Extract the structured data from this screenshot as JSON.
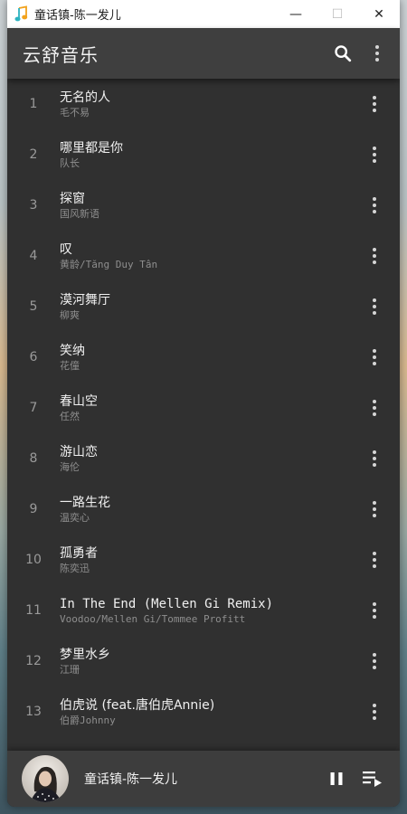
{
  "window": {
    "title": "童话镇-陈一发儿",
    "controls": {
      "minimize": "—",
      "maximize": "☐",
      "close": "✕"
    }
  },
  "appbar": {
    "title": "云舒音乐",
    "search_icon": "search-icon",
    "more_icon": "more-vert-icon"
  },
  "songs": [
    {
      "index": "1",
      "title": "无名的人",
      "artist": "毛不易"
    },
    {
      "index": "2",
      "title": "哪里都是你",
      "artist": "队长"
    },
    {
      "index": "3",
      "title": "探窗",
      "artist": "国风新语"
    },
    {
      "index": "4",
      "title": "叹",
      "artist": "黄龄/Tăng Duy Tân"
    },
    {
      "index": "5",
      "title": "漠河舞厅",
      "artist": "柳爽"
    },
    {
      "index": "6",
      "title": "笑纳",
      "artist": "花僮"
    },
    {
      "index": "7",
      "title": "春山空",
      "artist": "任然"
    },
    {
      "index": "8",
      "title": "游山恋",
      "artist": "海伦"
    },
    {
      "index": "9",
      "title": "一路生花",
      "artist": "温奕心"
    },
    {
      "index": "10",
      "title": "孤勇者",
      "artist": "陈奕迅"
    },
    {
      "index": "11",
      "title": "In The End (Mellen Gi Remix)",
      "artist": "Voodoo/Mellen Gi/Tommee Profitt"
    },
    {
      "index": "12",
      "title": "梦里水乡",
      "artist": "江珊"
    },
    {
      "index": "13",
      "title": "伯虎说 (feat.唐伯虎Annie)",
      "artist": "伯爵Johnny"
    }
  ],
  "player": {
    "now_playing": "童话镇-陈一发儿",
    "state": "playing"
  },
  "colors": {
    "appbar": "#3f3f3f",
    "list_bg": "#303030",
    "player_bg": "#3d3d3d"
  }
}
